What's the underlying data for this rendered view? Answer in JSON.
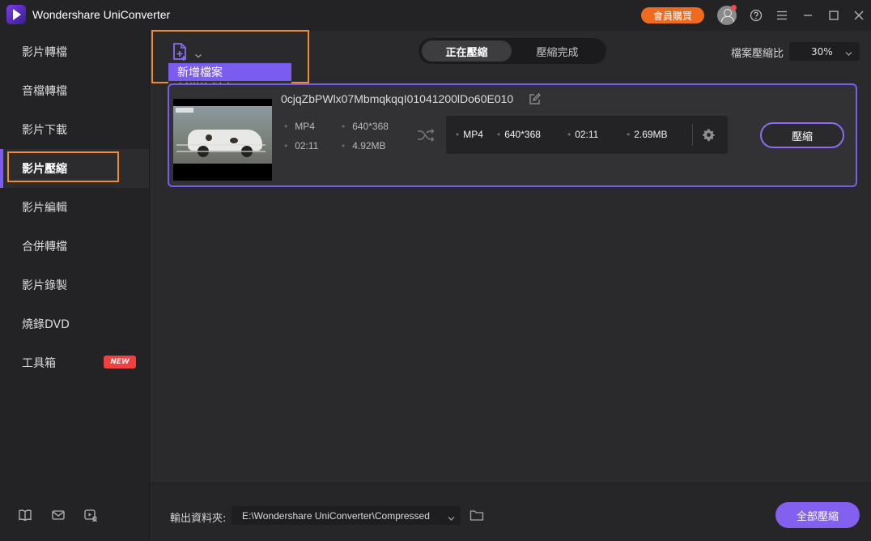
{
  "titlebar": {
    "app_title": "Wondershare UniConverter",
    "buy_label": "會員購買",
    "icons": [
      "avatar-icon",
      "help-icon",
      "menu-icon",
      "minimize-icon",
      "maximize-icon",
      "close-icon"
    ],
    "accent_color": "#f06a1e"
  },
  "sidebar": {
    "items": [
      {
        "label": "影片轉檔"
      },
      {
        "label": "音檔轉檔"
      },
      {
        "label": "影片下載"
      },
      {
        "label": "影片壓縮",
        "active": true
      },
      {
        "label": "影片編輯"
      },
      {
        "label": "合併轉檔"
      },
      {
        "label": "影片錄製"
      },
      {
        "label": "燒錄DVD"
      },
      {
        "label": "工具箱"
      }
    ],
    "new_badge": "NEW",
    "bottom_icons": [
      "book-icon",
      "mail-icon",
      "video-account-icon"
    ]
  },
  "toolbar": {
    "add_menu": {
      "items": [
        {
          "label": "新增檔案",
          "selected": true
        },
        {
          "label": "新增資料夾"
        }
      ]
    },
    "tabs": [
      {
        "label": "正在壓縮",
        "active": true
      },
      {
        "label": "壓縮完成"
      }
    ],
    "ratio_label": "檔案壓縮比",
    "ratio_value": "30%"
  },
  "file": {
    "name": "0cjqZbPWlx07MbmqkqqI01041200lDo60E010",
    "source": {
      "format": "MP4",
      "resolution": "640*368",
      "duration": "02:11",
      "size": "4.92MB"
    },
    "target": {
      "format": "MP4",
      "resolution": "640*368",
      "duration": "02:11",
      "size": "2.69MB"
    },
    "compress_label": "壓縮"
  },
  "footer": {
    "output_label": "輸出資料夾:",
    "output_path": "E:\\Wondershare UniConverter\\Compressed",
    "compress_all_label": "全部壓縮"
  },
  "colors": {
    "accent_purple": "#7b5cf0",
    "highlight_orange": "#f08a34"
  }
}
